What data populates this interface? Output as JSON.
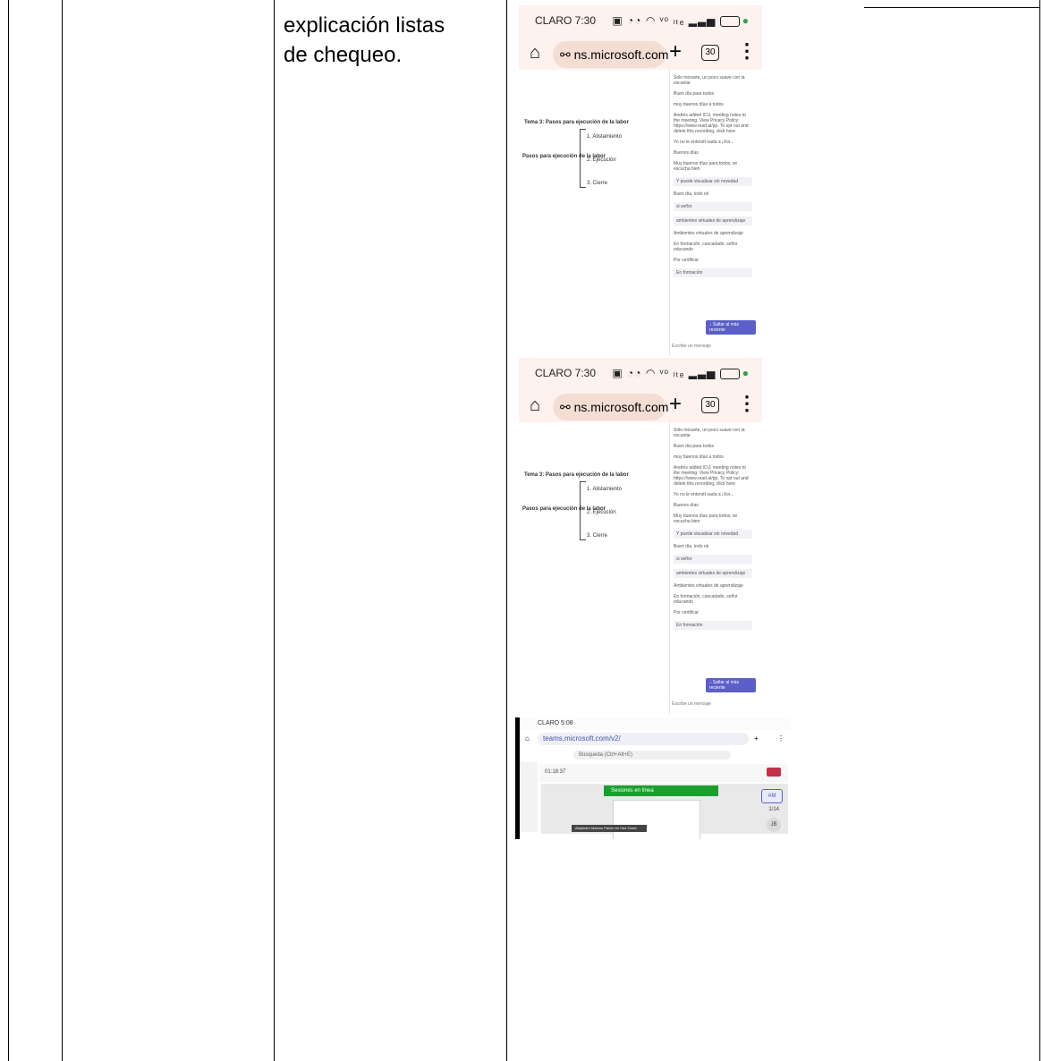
{
  "cell_text": {
    "line1": "explicación listas",
    "line2": "de chequeo."
  },
  "phone_shot": {
    "carrier_time": "CLARO 7:30",
    "status_icons": "ᵛᵒ ₗₜₑ",
    "url": "ns.microsoft.com",
    "tab_count": "30",
    "slide": {
      "title": "Tema 3: Pasos para ejecución de la labor",
      "node": "Pasos para ejecución de la labor",
      "items": [
        "1. Alistamiento",
        "2. Ejecución",
        "3. Cierre"
      ]
    },
    "chat": {
      "messages": [
        "Sólo mosarte, un poco suave con la escuelar",
        "Buen día para todos",
        "muy buenos días a todos",
        "Andrés added ICU, meeting notes to the meeting. View Privacy Policy: https://www.read.ai/pp. To opt out and delete this recording, click here",
        "Yo no le entendí nada a ¡Xor...",
        "Buenos días",
        "Muy buenos días para todos, se escucha bien",
        "Y puede visualizar sin novedad",
        "Buen día, todo ok",
        "si señor",
        "ambientes virtuales de aprendizaje",
        "Ambientes virtuales de aprendizaje",
        "En formación, cascadado, señor educando",
        "Por certificar",
        "En formación"
      ],
      "jump_button": "↓ Saltar al más reciente",
      "compose_placeholder": "Escribe un mensaje"
    }
  },
  "teams_shot": {
    "carrier_time": "CLARO 5:08",
    "url": "teams.microsoft.com/v2/",
    "search_placeholder": "Búsqueda (Ctrl+Alt+E)",
    "call_time": "01:18:37",
    "share_title": "Sesiones en línea",
    "tile_initials": "AM",
    "page_indicator": "1/14",
    "tile2_initials": "JB",
    "caption": "Alejandro Marcos Pavón en Haz Clase"
  }
}
